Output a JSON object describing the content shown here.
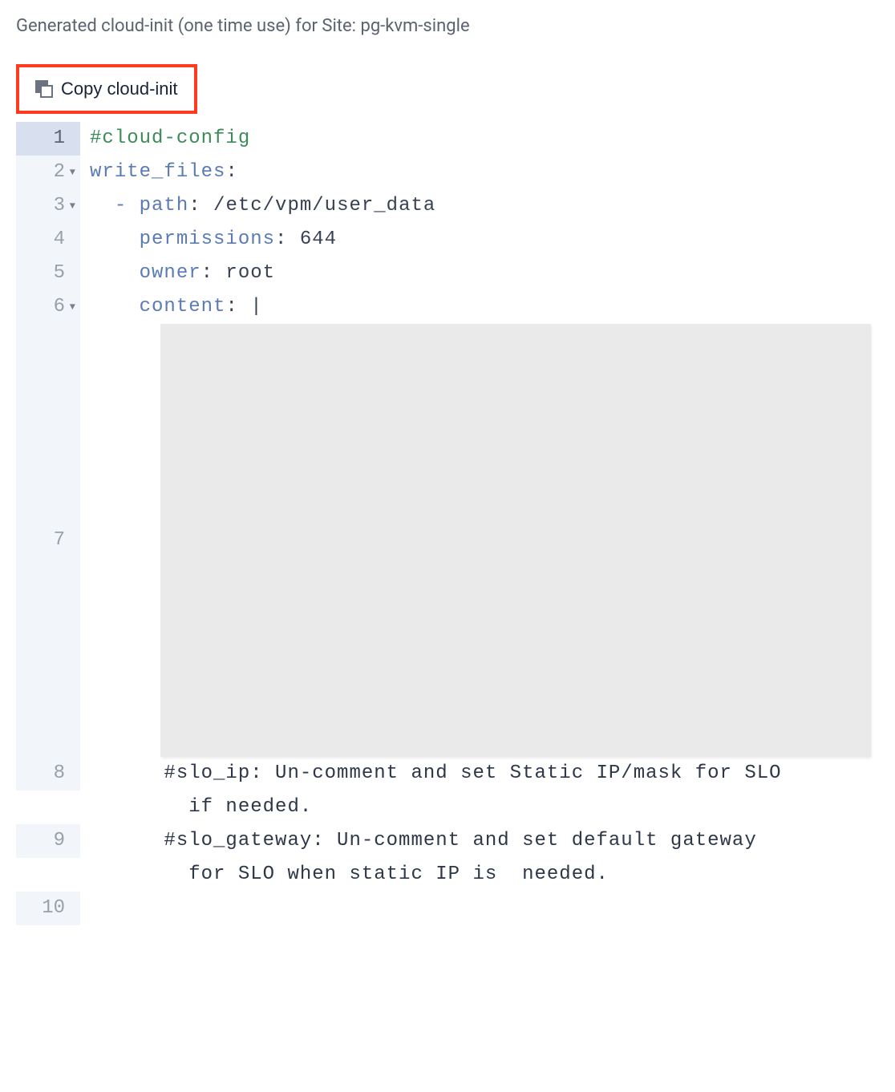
{
  "header": {
    "title": "Generated cloud-init (one time use) for Site: pg-kvm-single"
  },
  "toolbar": {
    "copy_label": "Copy cloud-init"
  },
  "editor": {
    "lines": [
      {
        "num": "1",
        "fold": false,
        "hl": true,
        "segments": [
          {
            "text": "#cloud-config",
            "cls": "c-comment"
          }
        ]
      },
      {
        "num": "2",
        "fold": true,
        "hl": false,
        "segments": [
          {
            "text": "write_files",
            "cls": "c-key"
          },
          {
            "text": ":",
            "cls": "c-val"
          }
        ]
      },
      {
        "num": "3",
        "fold": true,
        "hl": false,
        "segments": [
          {
            "text": "  ",
            "cls": ""
          },
          {
            "text": "-",
            "cls": "c-dash"
          },
          {
            "text": " ",
            "cls": ""
          },
          {
            "text": "path",
            "cls": "c-key"
          },
          {
            "text": ": /etc/vpm/user_data",
            "cls": "c-val"
          }
        ]
      },
      {
        "num": "4",
        "fold": false,
        "hl": false,
        "segments": [
          {
            "text": "    ",
            "cls": ""
          },
          {
            "text": "permissions",
            "cls": "c-key"
          },
          {
            "text": ": 644",
            "cls": "c-val"
          }
        ]
      },
      {
        "num": "5",
        "fold": false,
        "hl": false,
        "segments": [
          {
            "text": "    ",
            "cls": ""
          },
          {
            "text": "owner",
            "cls": "c-key"
          },
          {
            "text": ": root",
            "cls": "c-val"
          }
        ]
      },
      {
        "num": "6",
        "fold": true,
        "hl": false,
        "segments": [
          {
            "text": "    ",
            "cls": ""
          },
          {
            "text": "content",
            "cls": "c-key"
          },
          {
            "text": ": |",
            "cls": "c-val"
          }
        ]
      },
      {
        "num": "7",
        "fold": false,
        "hl": false,
        "redacted": true,
        "segments": []
      },
      {
        "num": "8",
        "fold": false,
        "hl": false,
        "wrap": true,
        "segments": [
          {
            "text": "      #slo_ip: Un-comment and set Static IP/mask for SLO if needed.",
            "cls": "c-hash"
          }
        ]
      },
      {
        "num": "9",
        "fold": false,
        "hl": false,
        "wrap": true,
        "segments": [
          {
            "text": "      #slo_gateway: Un-comment and set default gateway for SLO when static IP is  needed.",
            "cls": "c-hash"
          }
        ]
      },
      {
        "num": "10",
        "fold": false,
        "hl": false,
        "segments": []
      }
    ]
  }
}
